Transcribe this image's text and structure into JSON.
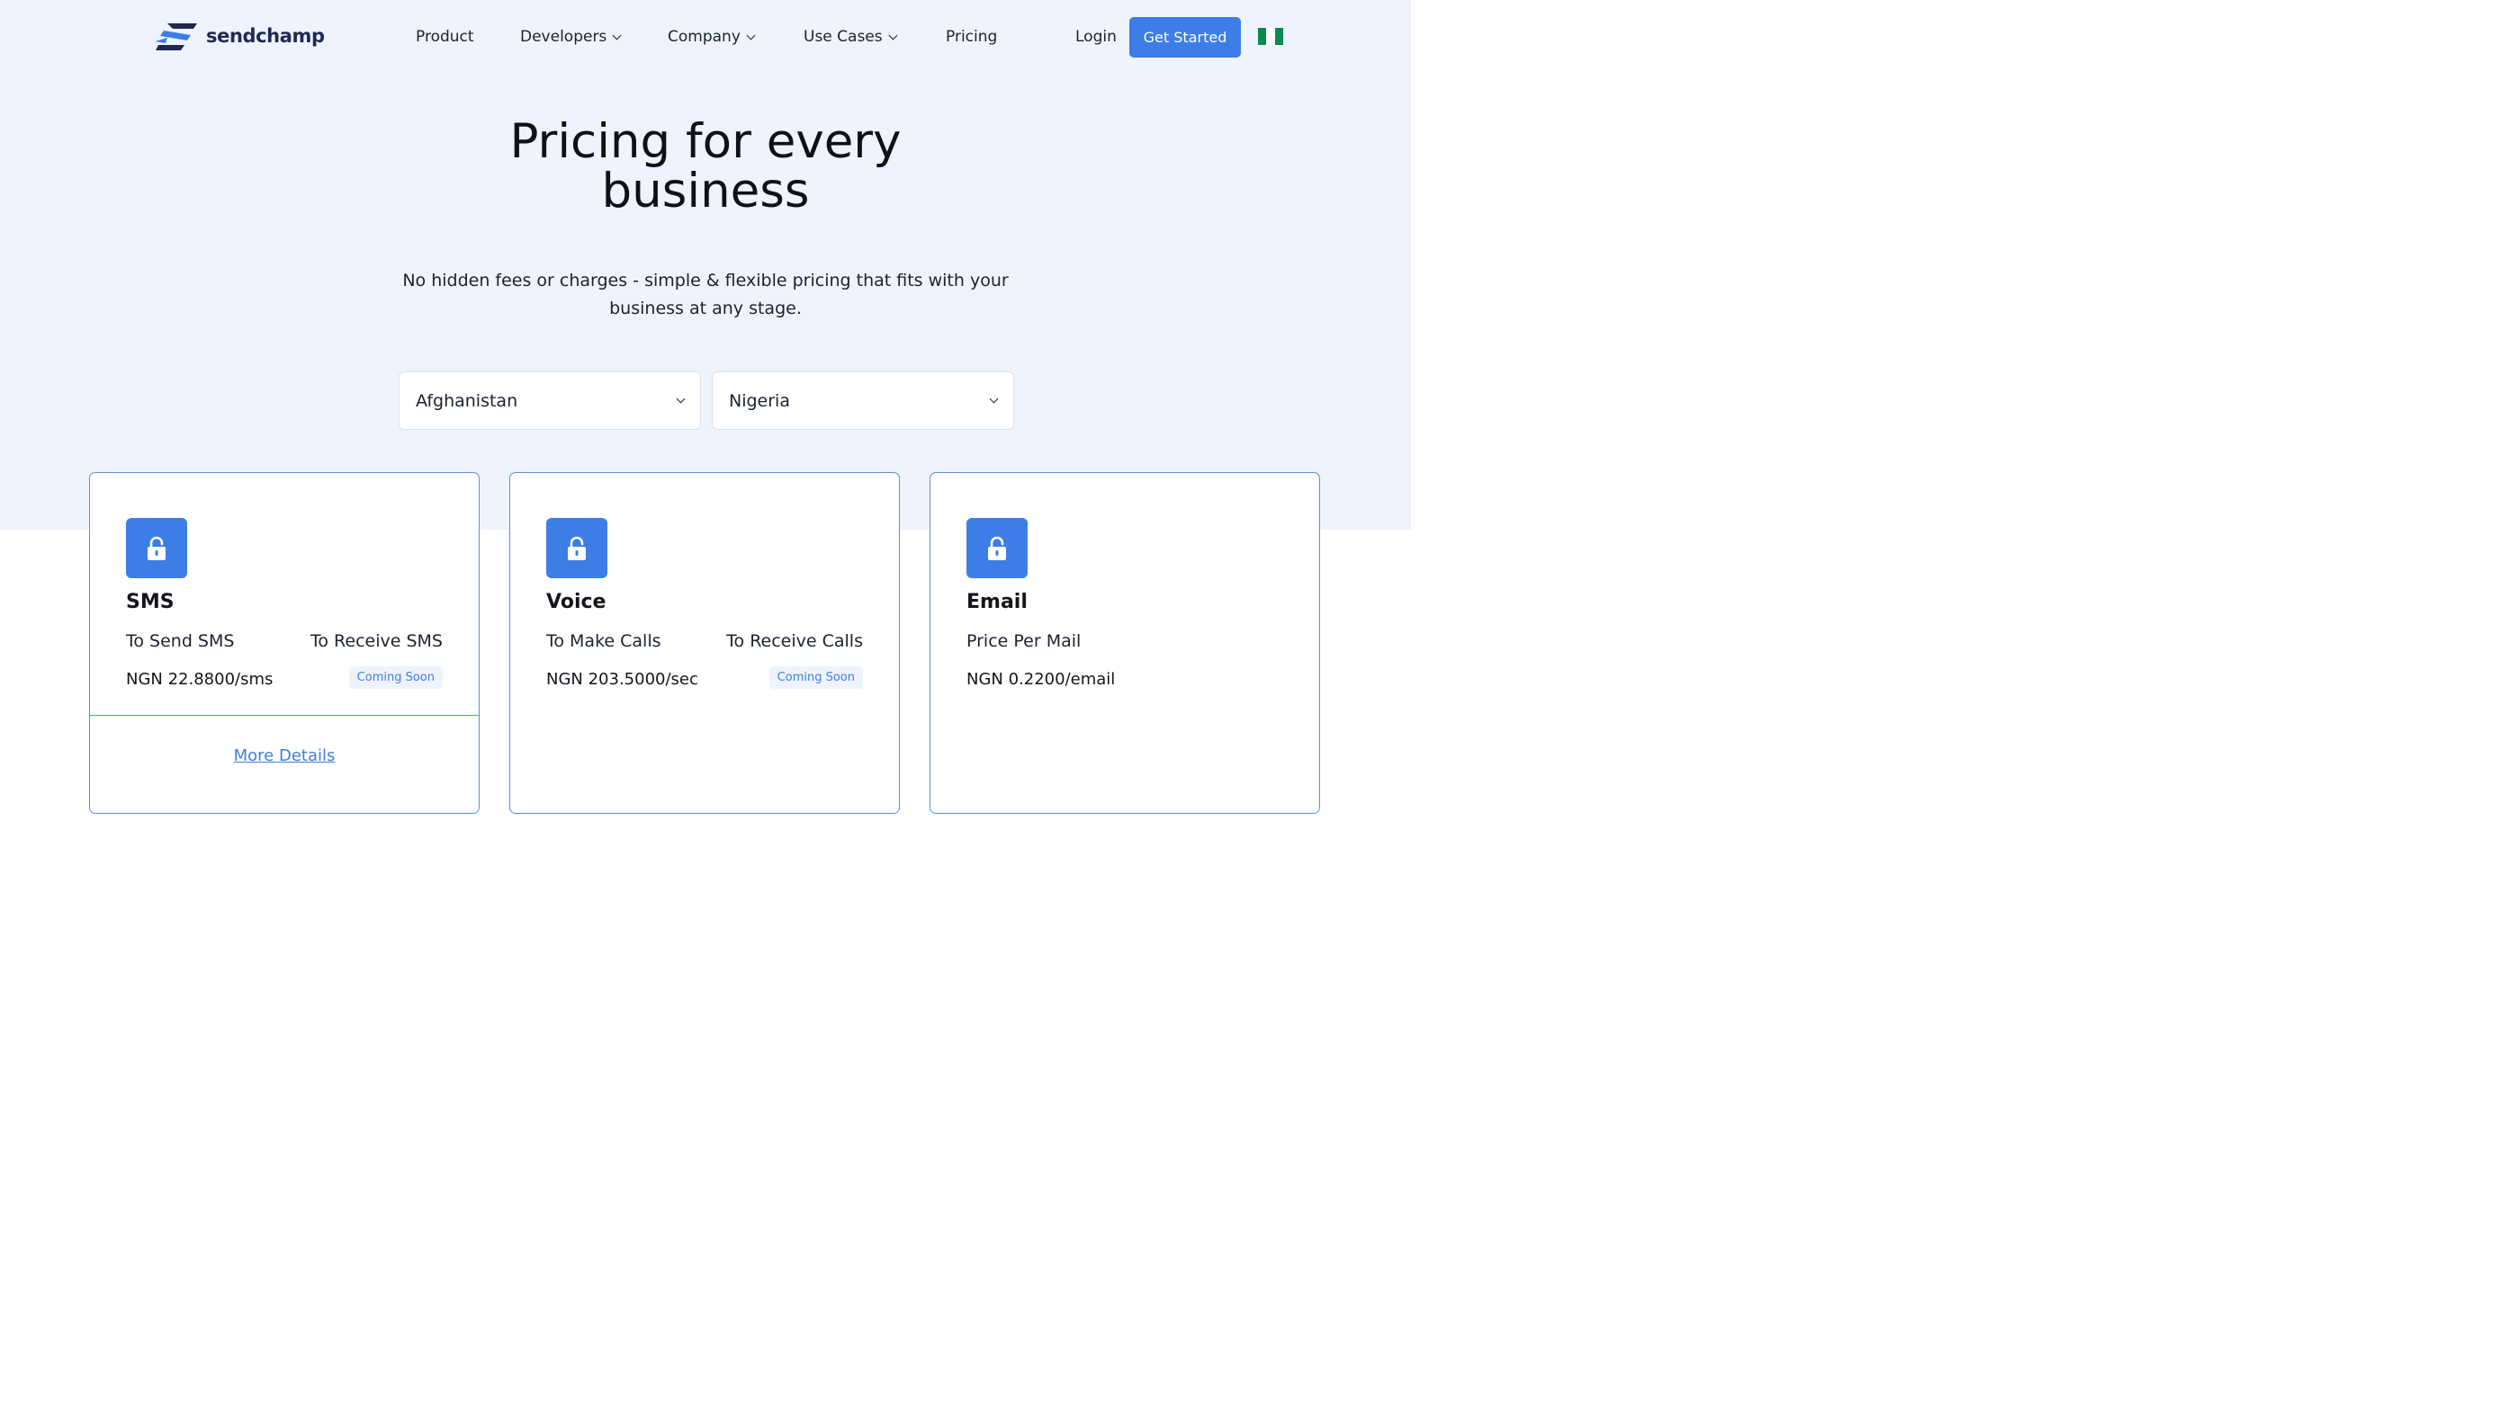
{
  "nav": {
    "logo_text": "sendchamp",
    "items": [
      {
        "label": "Product"
      },
      {
        "label": "Developers"
      },
      {
        "label": "Company"
      },
      {
        "label": "Use Cases"
      },
      {
        "label": "Pricing"
      }
    ],
    "login_label": "Login",
    "cta_label": "Get Started"
  },
  "hero": {
    "title_line1": "Pricing for every",
    "title_line2": "business",
    "subtitle": "No hidden fees or charges - simple & flexible pricing that fits with your business at any stage."
  },
  "filters": {
    "destination_country": "Afghanistan",
    "currency_country": "Nigeria"
  },
  "cards": [
    {
      "title": "SMS",
      "left_label": "To Send SMS",
      "right_label": "To Receive SMS",
      "price": "NGN 22.8800/sms",
      "badge": "Coming Soon",
      "link": "More Details"
    },
    {
      "title": "Voice",
      "left_label": "To Make Calls",
      "right_label": "To Receive Calls",
      "price": "NGN 203.5000/sec",
      "badge": "Coming Soon"
    },
    {
      "title": "Email",
      "left_label": "Price Per Mail",
      "price": "NGN 0.2200/email"
    }
  ],
  "colors": {
    "accent": "#3c7ee6",
    "hero_background": "#eef3fd",
    "card_border": "#5b8fe0",
    "flag_green": "#0a8a4e"
  },
  "icons": {
    "logo": "sendchamp-logo-icon",
    "card_icon": "unlock-icon",
    "dropdown": "chevron-down-icon",
    "language": "nigeria-flag-icon"
  }
}
